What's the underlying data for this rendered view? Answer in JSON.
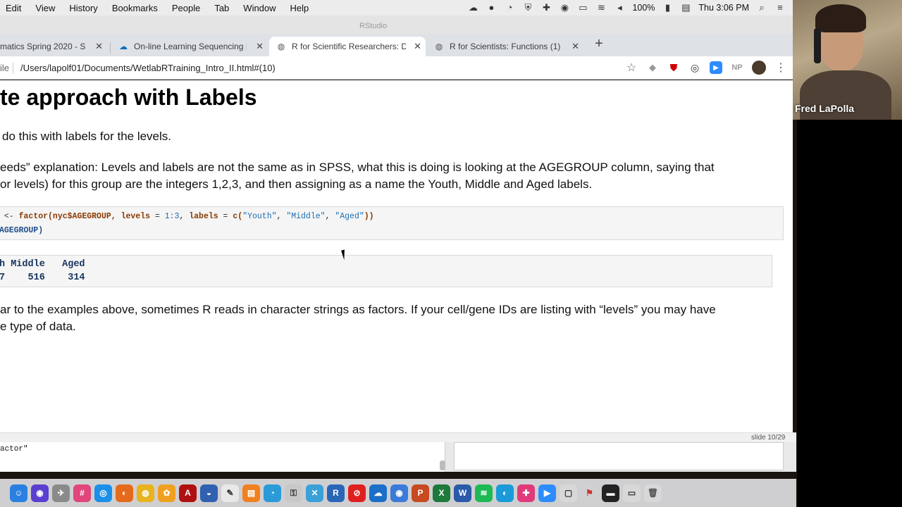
{
  "menubar": {
    "items": [
      "Edit",
      "View",
      "History",
      "Bookmarks",
      "People",
      "Tab",
      "Window",
      "Help"
    ],
    "battery": "100%",
    "clock": "Thu 3:06 PM"
  },
  "rstudio_title": "RStudio",
  "tabs": [
    {
      "label": "matics Spring 2020 - S",
      "icon": "page-icon"
    },
    {
      "label": "On-line Learning Sequencing I",
      "icon": "cloud-icon"
    },
    {
      "label": "R for Scientific Researchers: D",
      "icon": "globe-icon"
    },
    {
      "label": "R for Scientists: Functions (1)",
      "icon": "globe-icon"
    }
  ],
  "address": {
    "scheme_label": "ile",
    "url": "/Users/lapolf01/Documents/WetlabRTraining_Intro_II.html#(10)"
  },
  "extensions": {
    "np_label": "NP"
  },
  "slide": {
    "title": "te approach with Labels",
    "para1": "do this with labels for the levels.",
    "para2_line1": "eeds” explanation: Levels and labels are not the same as in SPSS, what this is doing is looking at the AGEGROUP column, saying that",
    "para2_line2": "or levels) for this group are the integers 1,2,3, and then assigning as a name the Youth, Middle and Aged labels.",
    "code": {
      "l1_op": " <- ",
      "l1_fn": "factor",
      "l1_arg1": "(nyc$AGEGROUP, ",
      "l1_kw1": "levels",
      "l1_eq1": " = ",
      "l1_num": "1:3",
      "l1_sep": ", ",
      "l1_kw2": "labels",
      "l1_eq2": " = ",
      "l1_c": "c(",
      "l1_s1": "\"Youth\"",
      "l1_c1": ", ",
      "l1_s2": "\"Middle\"",
      "l1_c2": ", ",
      "l1_s3": "\"Aged\"",
      "l1_close": "))",
      "l2": "AGEGROUP)"
    },
    "output": {
      "header": "h Middle   Aged",
      "values": "7    516    314"
    },
    "para3_line1": "ar to the examples above, sometimes R reads in character strings as factors. If your cell/gene IDs are listing with “levels” you may have",
    "para3_line2": "e type of data.",
    "slide_counter": "slide 10/29"
  },
  "console_snippet": "actor\"",
  "video": {
    "participant_name": "Fred LaPolla"
  },
  "dock": [
    "finder",
    "siri",
    "launchpad",
    "slack",
    "safari",
    "firefox",
    "chrome",
    "photos",
    "acrobat",
    "proxy",
    "textedit",
    "books",
    "preview",
    "keychain",
    "xquartz",
    "r",
    "news",
    "onedrive",
    "network",
    "powerpoint",
    "excel",
    "word",
    "spotify",
    "vpn",
    "slack2",
    "zoom",
    "files",
    "maps",
    "terminal",
    "archive",
    "trash"
  ]
}
